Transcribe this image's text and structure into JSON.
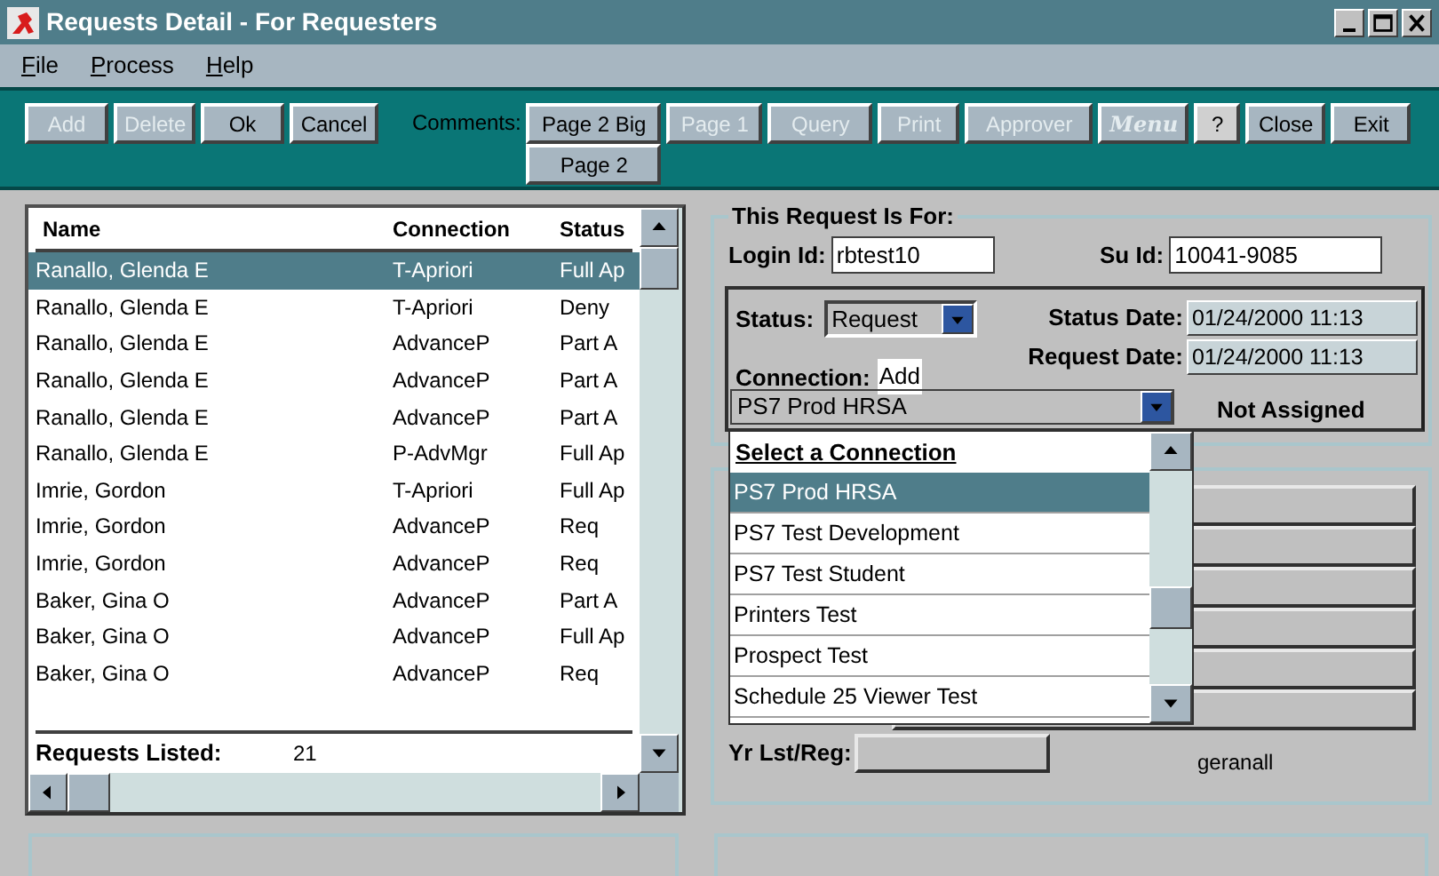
{
  "window": {
    "title": "Requests Detail - For Requesters"
  },
  "menu": [
    {
      "label": "File"
    },
    {
      "label": "Process"
    },
    {
      "label": "Help"
    }
  ],
  "toolbar": {
    "left_buttons": [
      {
        "label": "Add",
        "disabled": true
      },
      {
        "label": "Delete",
        "disabled": true
      },
      {
        "label": "Ok",
        "disabled": false
      },
      {
        "label": "Cancel",
        "disabled": false
      }
    ],
    "comments_label": "Comments:",
    "comment_buttons": [
      {
        "label": "Page 2 Big"
      },
      {
        "label": "Page 2"
      }
    ],
    "right_buttons": [
      {
        "label": "Page 1",
        "disabled": true,
        "kind": "plain",
        "pressed": false
      },
      {
        "label": "Query",
        "disabled": true,
        "kind": "plain",
        "pressed": false
      },
      {
        "label": "Print",
        "disabled": true,
        "kind": "plain",
        "pressed": false
      },
      {
        "label": "Approver",
        "disabled": true,
        "kind": "plain",
        "pressed": false
      },
      {
        "label": "Menu",
        "disabled": true,
        "kind": "italic",
        "pressed": false
      },
      {
        "label": "?",
        "disabled": false,
        "kind": "plain",
        "pressed": true
      },
      {
        "label": "Close",
        "disabled": false,
        "kind": "plain",
        "pressed": false
      },
      {
        "label": "Exit",
        "disabled": false,
        "kind": "plain",
        "pressed": false
      }
    ]
  },
  "requests": {
    "columns": [
      "Name",
      "Connection",
      "Status"
    ],
    "rows": [
      {
        "name": "Ranallo, Glenda E",
        "connection": "T-Apriori",
        "status": "Full Ap",
        "selected": true
      },
      {
        "name": "Ranallo, Glenda E",
        "connection": "T-Apriori",
        "status": "Deny",
        "selected": false
      },
      {
        "name": "Ranallo, Glenda E",
        "connection": "AdvanceP",
        "status": "Part A",
        "selected": false
      },
      {
        "name": "Ranallo, Glenda E",
        "connection": "AdvanceP",
        "status": "Part A",
        "selected": false
      },
      {
        "name": "Ranallo, Glenda E",
        "connection": "AdvanceP",
        "status": "Part A",
        "selected": false
      },
      {
        "name": "Ranallo, Glenda E",
        "connection": "P-AdvMgr",
        "status": "Full Ap",
        "selected": false
      },
      {
        "name": "Imrie, Gordon",
        "connection": "T-Apriori",
        "status": "Full Ap",
        "selected": false
      },
      {
        "name": "Imrie, Gordon",
        "connection": "AdvanceP",
        "status": "Req",
        "selected": false
      },
      {
        "name": "Imrie, Gordon",
        "connection": "AdvanceP",
        "status": "Req",
        "selected": false
      },
      {
        "name": "Baker, Gina O",
        "connection": "AdvanceP",
        "status": "Part A",
        "selected": false
      },
      {
        "name": "Baker, Gina O",
        "connection": "AdvanceP",
        "status": "Full Ap",
        "selected": false
      },
      {
        "name": "Baker, Gina O",
        "connection": "AdvanceP",
        "status": "Req",
        "selected": false
      }
    ],
    "footer_label": "Requests Listed:",
    "count": "21"
  },
  "request_for": {
    "title": "This Request Is For:",
    "login_label": "Login Id:",
    "login_value": "rbtest10",
    "su_label": "Su Id:",
    "su_value": "10041-9085",
    "status_label": "Status:",
    "status_value": "Request",
    "status_date_label": "Status Date:",
    "status_date": "01/24/2000 11:13",
    "request_date_label": "Request Date:",
    "request_date": "01/24/2000 11:13",
    "connection_label": "Connection:",
    "connection_action": "Add",
    "connection_value": "PS7 Prod HRSA",
    "assignment": "Not Assigned"
  },
  "dropdown": {
    "header": "Select a Connection",
    "options": [
      {
        "label": "PS7 Prod HRSA",
        "selected": true
      },
      {
        "label": "PS7 Test Development",
        "selected": false
      },
      {
        "label": "PS7 Test Student",
        "selected": false
      },
      {
        "label": "Printers Test",
        "selected": false
      },
      {
        "label": "Prospect Test",
        "selected": false
      },
      {
        "label": "Schedule 25 Viewer Test",
        "selected": false
      }
    ]
  },
  "details": {
    "yr_label": "Yr Lst/Reg:",
    "user": "geranall"
  }
}
